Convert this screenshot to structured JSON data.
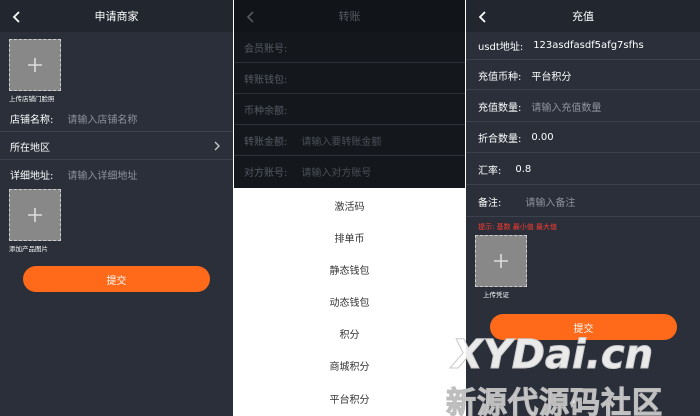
{
  "merchant": {
    "title": "申请商家",
    "shop_photo_caption": "上传店铺门脸照",
    "shop_name_label": "店铺名称:",
    "shop_name_placeholder": "请输入店铺名称",
    "region_label": "所在地区",
    "address_label": "详细地址:",
    "address_placeholder": "请输入详细地址",
    "product_photo_caption": "添加产品图片",
    "submit_label": "提交"
  },
  "transfer": {
    "title": "转账",
    "rows": [
      {
        "label": "会员账号:",
        "placeholder": ""
      },
      {
        "label": "转账钱包:",
        "placeholder": ""
      },
      {
        "label": "币种余额:",
        "placeholder": ""
      },
      {
        "label": "转账金额:",
        "placeholder": "请输入要转账金额"
      },
      {
        "label": "对方账号:",
        "placeholder": "请输入对方账号"
      }
    ],
    "wallet_options": [
      "激活码",
      "排单币",
      "静态钱包",
      "动态钱包",
      "积分",
      "商城积分",
      "平台积分"
    ]
  },
  "recharge": {
    "title": "充值",
    "usdt_label": "usdt地址:",
    "usdt_value": "123asdfasdf5afg7sfhs",
    "currency_label": "充值币种:",
    "currency_value": "平台积分",
    "amount_label": "充值数量:",
    "amount_placeholder": "请输入充值数量",
    "converted_label": "折合数量:",
    "converted_value": "0.00",
    "rate_label": "汇率:",
    "rate_value": "0.8",
    "note_label": "备注:",
    "note_placeholder": "请输入备注",
    "hint": "提示: 基数 最小值 最大值",
    "voucher_caption": "上传凭证",
    "submit_label": "提交"
  },
  "watermark": {
    "line1": "XYDai.cn",
    "line2": "新源代源码社区"
  },
  "colors": {
    "panel_bg": "#2a2f3a",
    "accent_orange": "#ff6a1a",
    "hint_red": "#ff3b30"
  }
}
